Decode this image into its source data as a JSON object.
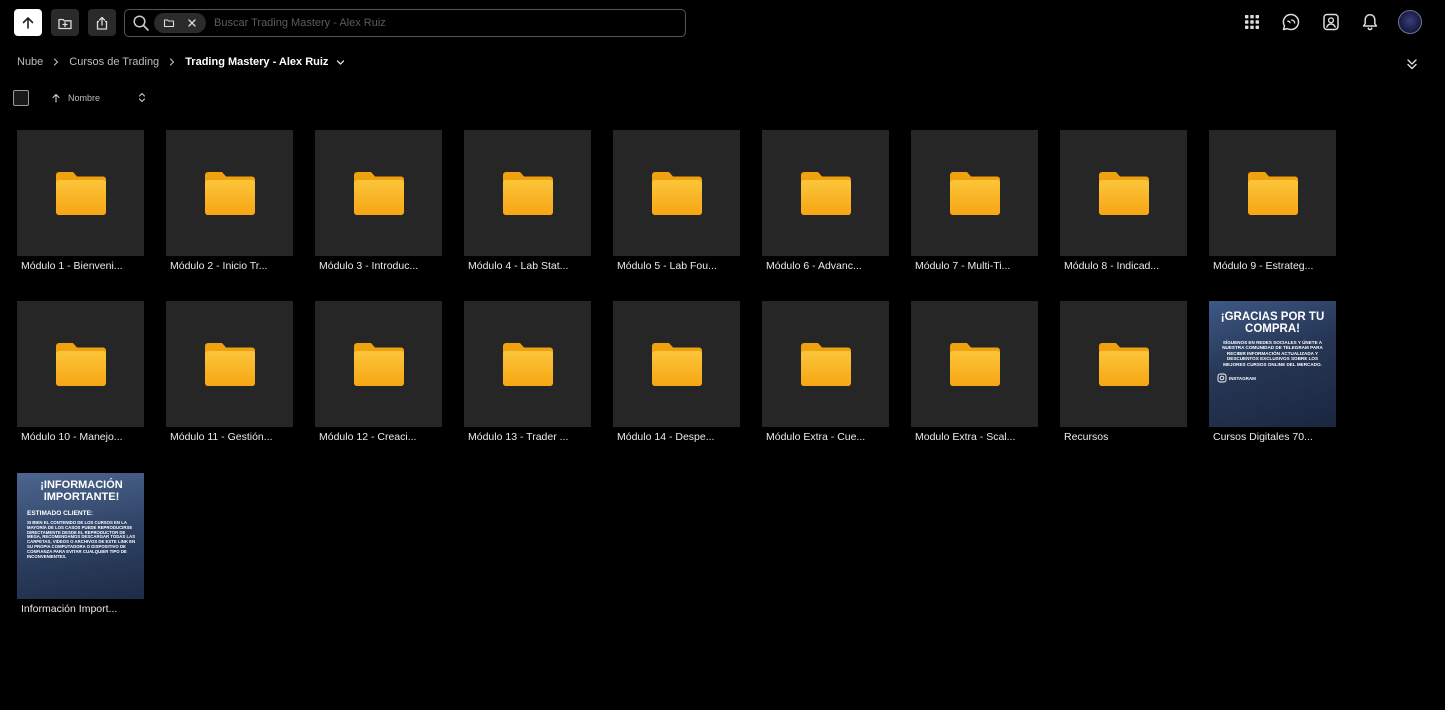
{
  "toolbar": {
    "upload_label": "Upload",
    "new_folder_label": "New folder",
    "share_label": "Share"
  },
  "search": {
    "placeholder": "Buscar Trading Mastery - Alex Ruiz",
    "value": ""
  },
  "header_icons": [
    "apps-grid-icon",
    "chat-icon",
    "contacts-icon",
    "bell-icon",
    "avatar"
  ],
  "breadcrumb": {
    "root": "Nube",
    "parent": "Cursos de Trading",
    "current": "Trading Mastery - Alex Ruiz"
  },
  "sort": {
    "label": "Nombre",
    "direction": "ascending"
  },
  "items": [
    {
      "name": "Módulo 1 - Bienveni...",
      "type": "folder"
    },
    {
      "name": "Módulo 2 - Inicio Tr...",
      "type": "folder"
    },
    {
      "name": "Módulo 3 - Introduc...",
      "type": "folder"
    },
    {
      "name": "Módulo 4 - Lab Stat...",
      "type": "folder"
    },
    {
      "name": "Módulo 5 - Lab Fou...",
      "type": "folder"
    },
    {
      "name": "Módulo 6 - Advanc...",
      "type": "folder"
    },
    {
      "name": "Módulo 7 - Multi-Ti...",
      "type": "folder"
    },
    {
      "name": "Módulo 8 - Indicad...",
      "type": "folder"
    },
    {
      "name": "Módulo 9 - Estrateg...",
      "type": "folder"
    },
    {
      "name": "Módulo 10 - Manejo...",
      "type": "folder"
    },
    {
      "name": "Módulo 11 - Gestión...",
      "type": "folder"
    },
    {
      "name": "Módulo 12 - Creaci...",
      "type": "folder"
    },
    {
      "name": "Módulo 13 - Trader ...",
      "type": "folder"
    },
    {
      "name": "Módulo 14 - Despe...",
      "type": "folder"
    },
    {
      "name": "Módulo Extra - Cue...",
      "type": "folder"
    },
    {
      "name": "Modulo Extra - Scal...",
      "type": "folder"
    },
    {
      "name": "Recursos",
      "type": "folder"
    },
    {
      "name": "Cursos Digitales 70...",
      "type": "image"
    },
    {
      "name": "Información Import...",
      "type": "image"
    }
  ],
  "promo_image": {
    "title": "¡GRACIAS POR TU COMPRA!",
    "body": "SÍGUENOS EN REDES SOCIALES Y ÚNETE A NUESTRA COMUNIDAD DE TELEGRAM PARA RECIBIR INFORMACIÓN ACTUALIZADA Y DESCUENTOS EXCLUSIVOS SOBRE LOS MEJORES CURSOS ONLINE DEL MERCADO.",
    "social": "INSTAGRAM"
  },
  "info_image": {
    "title": "¡INFORMACIÓN IMPORTANTE!",
    "subtitle": "ESTIMADO CLIENTE:",
    "body": "SI BIEN EL CONTENIDO DE LOS CURSOS EN LA MAYORÍA DE LOS CASOS PUEDE REPRODUCIRSE DIRECTAMENTE DESDE EL REPRODUCTOR DE MEGA, RECOMENDAMOS DESCARGAR TODAS LAS CARPETAS, VIDEOS O ARCHIVOS DE ESTE LINK EN SU PROPIA COMPUTADORA O DISPOSITIVO DE CONFIANZA PARA EVITAR CUALQUIER TIPO DE INCONVENIENTES."
  },
  "colors": {
    "background": "#000000",
    "tile": "#262626",
    "folder": "#fbbf24",
    "folder_tab": "#f59e0b"
  }
}
